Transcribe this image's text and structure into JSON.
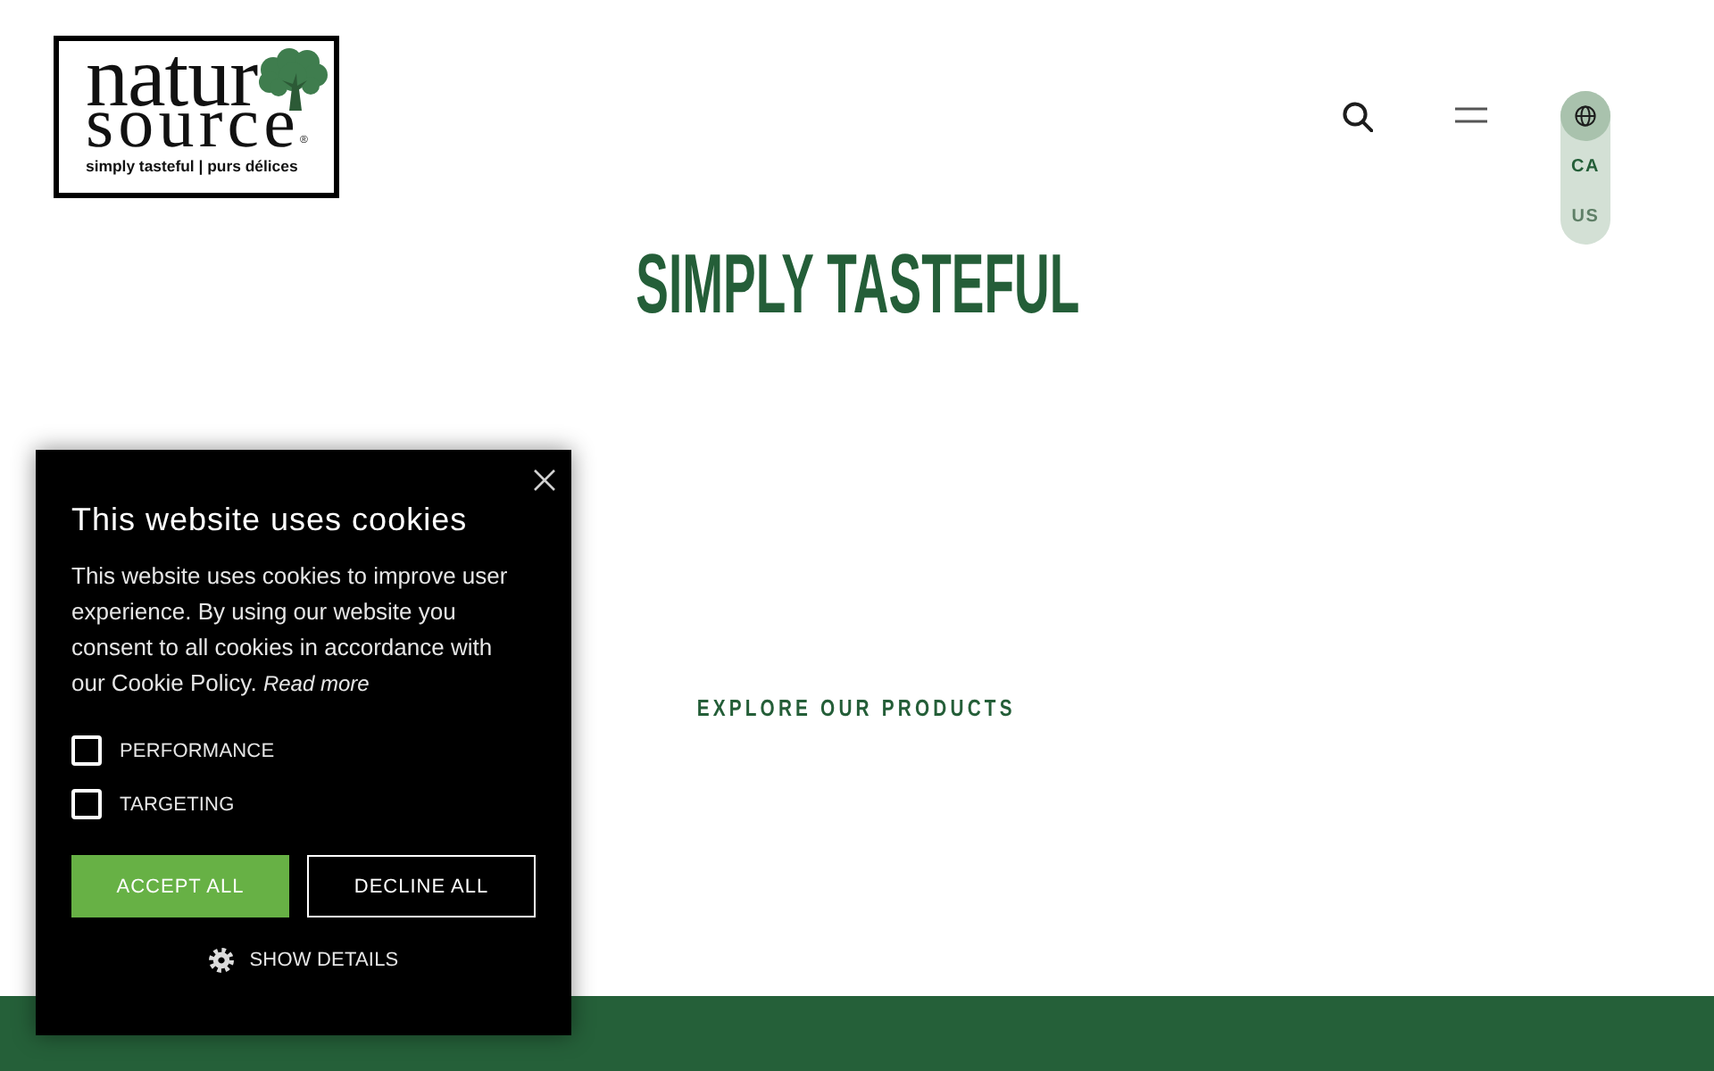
{
  "header": {
    "logo": {
      "wordmark": [
        "natur",
        "source"
      ],
      "registered_mark": "®",
      "tagline": "simply tasteful | purs délices"
    },
    "region_options": [
      {
        "label": "CA",
        "selected": true
      },
      {
        "label": "US",
        "selected": false
      }
    ]
  },
  "hero": {
    "title": "SIMPLY TASTEFUL",
    "link": "EXPLORE OUR PRODUCTS"
  },
  "cookie_banner": {
    "title": "This website uses cookies",
    "body": "This website uses cookies to improve user experience. By using our website you consent to all cookies in accordance with our Cookie Policy.",
    "read_more": "Read more",
    "options": [
      {
        "label": "PERFORMANCE",
        "checked": false
      },
      {
        "label": "TARGETING",
        "checked": false
      }
    ],
    "buttons": [
      {
        "label": "ACCEPT ALL",
        "kind": "primary"
      },
      {
        "label": "DECLINE ALL",
        "kind": "secondary"
      }
    ],
    "details_link": "SHOW DETAILS"
  }
}
